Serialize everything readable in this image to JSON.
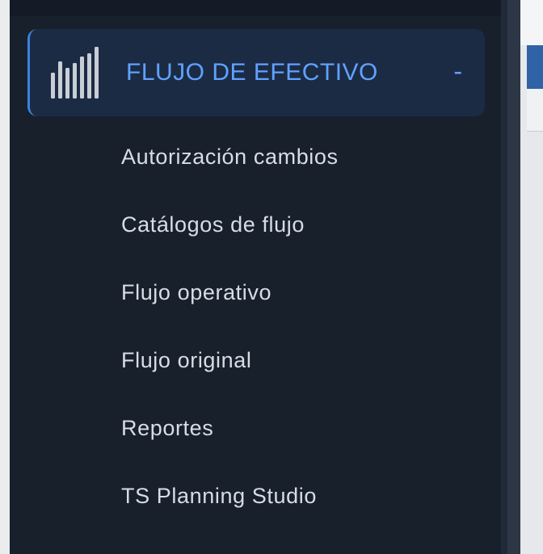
{
  "sidebar": {
    "section": {
      "title": "FLUJO DE EFECTIVO",
      "toggle": "-",
      "icon": "bar-chart-icon",
      "accent_color": "#5fa2ff",
      "expanded": true
    },
    "items": [
      {
        "label": "Autorización cambios"
      },
      {
        "label": "Catálogos de flujo"
      },
      {
        "label": "Flujo operativo"
      },
      {
        "label": "Flujo original"
      },
      {
        "label": "Reportes"
      },
      {
        "label": "TS Planning Studio"
      }
    ]
  },
  "colors": {
    "sidebar_bg": "#18202c",
    "header_bg": "#1c2b44",
    "item_text": "#d8dde5"
  }
}
